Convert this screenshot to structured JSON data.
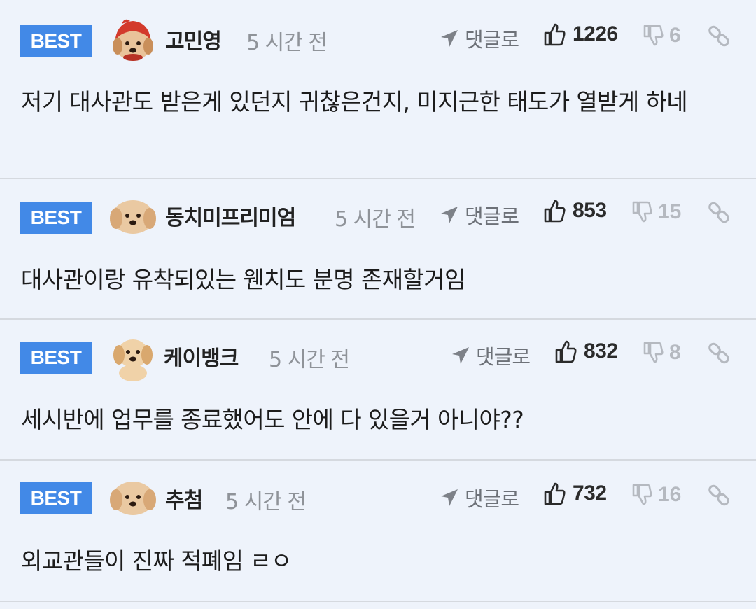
{
  "comments": [
    {
      "badge": "BEST",
      "avatar": "puppy-red-hood-avatar",
      "username": "고민영",
      "time": "5 시간 전",
      "reply_label": "댓글로",
      "likes": "1226",
      "dislikes": "6",
      "text": "저기 대사관도 받은게 있던지 귀찮은건지, 미지근한 태도가 열받게 하네"
    },
    {
      "badge": "BEST",
      "avatar": "puppy-face-avatar",
      "username": "동치미프리미엄",
      "time": "5 시간 전",
      "reply_label": "댓글로",
      "likes": "853",
      "dislikes": "15",
      "text": "대사관이랑 유착되있는 웬치도 분명 존재할거임"
    },
    {
      "badge": "BEST",
      "avatar": "puppy-sitting-avatar",
      "username": "케이뱅크",
      "time": "5 시간 전",
      "reply_label": "댓글로",
      "likes": "832",
      "dislikes": "8",
      "text": "세시반에 업무를 종료했어도 안에 다 있을거 아니야??"
    },
    {
      "badge": "BEST",
      "avatar": "puppy-face-avatar",
      "username": "추첨",
      "time": "5 시간 전",
      "reply_label": "댓글로",
      "likes": "732",
      "dislikes": "16",
      "text": "외교관들이 진짜 적폐임 ㄹㅇ"
    }
  ],
  "colors": {
    "badge_bg": "#4289e7",
    "page_bg": "#eef3fb",
    "muted": "#8f9399",
    "dislike": "#b5b9c0"
  }
}
